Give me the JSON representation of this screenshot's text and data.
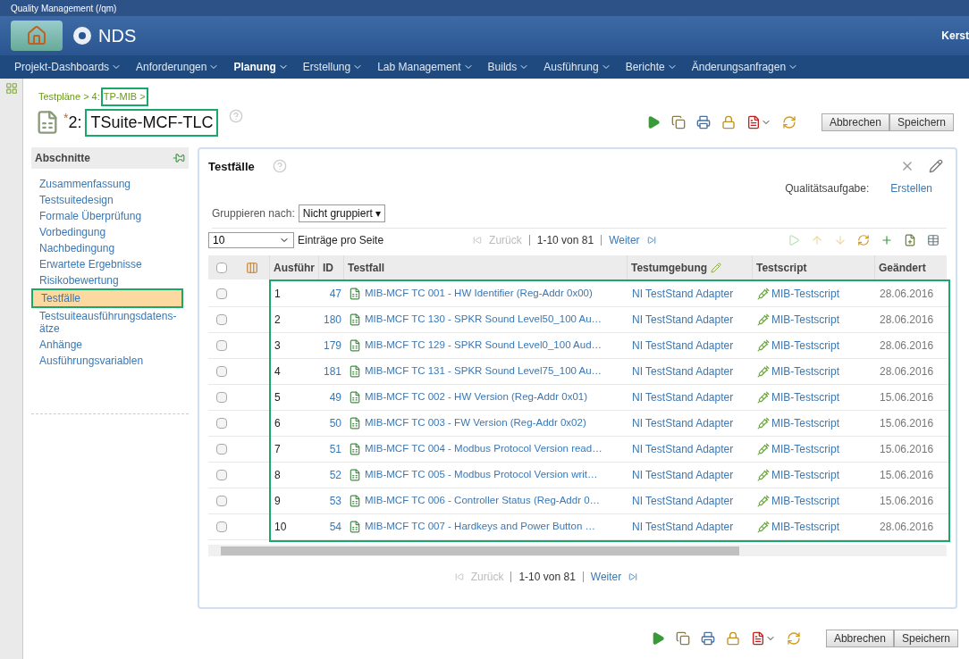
{
  "app_title": "Quality Management (/qm)",
  "product": "NDS",
  "user": "Kerst",
  "nav": [
    {
      "label": "Projekt-Dashboards",
      "selected": false
    },
    {
      "label": "Anforderungen",
      "selected": false
    },
    {
      "label": "Planung",
      "selected": true
    },
    {
      "label": "Erstellung",
      "selected": false
    },
    {
      "label": "Lab Management",
      "selected": false
    },
    {
      "label": "Builds",
      "selected": false
    },
    {
      "label": "Ausführung",
      "selected": false
    },
    {
      "label": "Berichte",
      "selected": false
    },
    {
      "label": "Änderungsanfragen",
      "selected": false
    }
  ],
  "breadcrumb": {
    "path": "Testpläne > 4:",
    "current": "TP-MIB >"
  },
  "title": {
    "number": "2:",
    "name": "TSuite-MCF-TLC",
    "modified_mark": "*"
  },
  "top_buttons": [
    "Abbrechen",
    "Speichern"
  ],
  "sidebar": {
    "heading": "Abschnitte",
    "items": [
      {
        "label": "Zusammenfassung",
        "selected": false
      },
      {
        "label": "Testsuitedesign",
        "selected": false
      },
      {
        "label": "Formale Überprüfung",
        "selected": false
      },
      {
        "label": "Vorbedingung",
        "selected": false
      },
      {
        "label": "Nachbedingung",
        "selected": false
      },
      {
        "label": "Erwartete Ergebnisse",
        "selected": false
      },
      {
        "label": "Risikobewertung",
        "selected": false
      },
      {
        "label": "Testfälle",
        "selected": true
      },
      {
        "label": "Testsuiteausführungsdatens-ätze",
        "selected": false
      },
      {
        "label": "Anhänge",
        "selected": false
      },
      {
        "label": "Ausführungsvariablen",
        "selected": false
      }
    ]
  },
  "panel": {
    "title": "Testfälle",
    "quality_label": "Qualitätsaufgabe:",
    "quality_link": "Erstellen",
    "group_label": "Gruppieren nach:",
    "group_value": "Nicht gruppiert ▾",
    "page_size": "10",
    "page_size_label": "Einträge pro Seite",
    "pager_top": {
      "prev": "Zurück",
      "range": "1-10 von 81",
      "next": "Weiter"
    },
    "pager_bottom": {
      "prev": "Zurück",
      "range": "1-10 von 81",
      "next": "Weiter"
    },
    "select_all_checked": false,
    "columns": [
      "Ausführ",
      "ID",
      "Testfall",
      "Testumgebung",
      "Testscript",
      "Geändert"
    ],
    "rows": [
      {
        "order": "1",
        "id": "47",
        "name": "MIB-MCF TC 001 - HW Identifier (Reg-Addr 0x00)",
        "env": "NI TestStand Adapter",
        "script": "MIB-Testscript",
        "changed": "28.06.2016",
        "checked": false
      },
      {
        "order": "2",
        "id": "180",
        "name": "MIB-MCF TC 130 - SPKR Sound Level50_100 Au…",
        "env": "NI TestStand Adapter",
        "script": "MIB-Testscript",
        "changed": "28.06.2016",
        "checked": false
      },
      {
        "order": "3",
        "id": "179",
        "name": "MIB-MCF TC 129 - SPKR Sound Level0_100 Aud…",
        "env": "NI TestStand Adapter",
        "script": "MIB-Testscript",
        "changed": "28.06.2016",
        "checked": false
      },
      {
        "order": "4",
        "id": "181",
        "name": "MIB-MCF TC 131 - SPKR Sound Level75_100 Au…",
        "env": "NI TestStand Adapter",
        "script": "MIB-Testscript",
        "changed": "28.06.2016",
        "checked": false
      },
      {
        "order": "5",
        "id": "49",
        "name": "MIB-MCF TC 002 - HW Version (Reg-Addr 0x01)",
        "env": "NI TestStand Adapter",
        "script": "MIB-Testscript",
        "changed": "15.06.2016",
        "checked": false
      },
      {
        "order": "6",
        "id": "50",
        "name": "MIB-MCF TC 003 - FW Version (Reg-Addr 0x02)",
        "env": "NI TestStand Adapter",
        "script": "MIB-Testscript",
        "changed": "15.06.2016",
        "checked": false
      },
      {
        "order": "7",
        "id": "51",
        "name": "MIB-MCF TC 004 - Modbus Protocol Version read…",
        "env": "NI TestStand Adapter",
        "script": "MIB-Testscript",
        "changed": "15.06.2016",
        "checked": false
      },
      {
        "order": "8",
        "id": "52",
        "name": "MIB-MCF TC 005 - Modbus Protocol Version writ…",
        "env": "NI TestStand Adapter",
        "script": "MIB-Testscript",
        "changed": "15.06.2016",
        "checked": false
      },
      {
        "order": "9",
        "id": "53",
        "name": "MIB-MCF TC 006 - Controller Status (Reg-Addr 0…",
        "env": "NI TestStand Adapter",
        "script": "MIB-Testscript",
        "changed": "15.06.2016",
        "checked": false
      },
      {
        "order": "10",
        "id": "54",
        "name": "MIB-MCF TC 007 - Hardkeys and Power Button …",
        "env": "NI TestStand Adapter",
        "script": "MIB-Testscript",
        "changed": "28.06.2016",
        "checked": false
      }
    ]
  },
  "bottom_buttons": [
    "Abbrechen",
    "Speichern"
  ]
}
